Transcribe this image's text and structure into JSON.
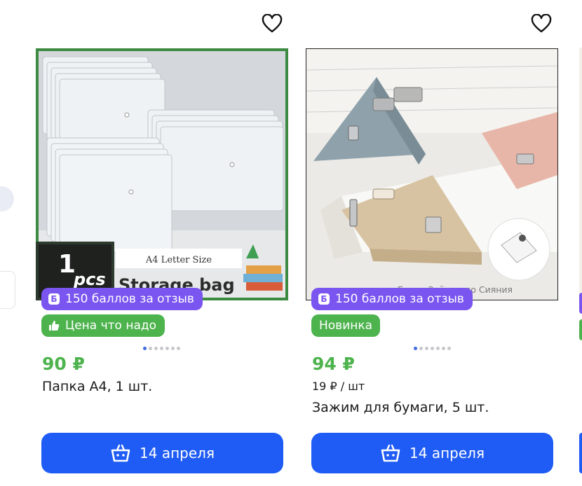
{
  "products": [
    {
      "image_alt": "Storage bag",
      "image_text": {
        "size": "A4 Letter Size",
        "qty": "1",
        "unit": "pcs",
        "name": "Storage bag"
      },
      "points_badge": {
        "icon": "b-points-icon",
        "text": "150 баллов за отзыв"
      },
      "tag_badge": {
        "icon": "thumbs-up-icon",
        "text": "Цена что надо",
        "color": "#4db34d"
      },
      "price": "90 ₽",
      "unit_price": "",
      "title": "Папка А4, 1 шт.",
      "button": {
        "icon": "basket-icon",
        "label": "14 апреля"
      },
      "carousel": {
        "count": 7,
        "active": 0
      }
    },
    {
      "image_alt": "Зажим для бумаги",
      "image_text": {
        "watermark": "Белое Звёздного Сияния"
      },
      "points_badge": {
        "icon": "b-points-icon",
        "text": "150 баллов за отзыв"
      },
      "tag_badge": {
        "icon": "",
        "text": "Новинка",
        "color": "#4db34d"
      },
      "price": "94 ₽",
      "unit_price": "19 ₽ / шт",
      "title": "Зажим для бумаги, 5 шт.",
      "button": {
        "icon": "basket-icon",
        "label": "14 апреля"
      },
      "carousel": {
        "count": 7,
        "active": 0
      }
    }
  ],
  "colors": {
    "accent": "#1f5cf5",
    "points": "#7a55f0",
    "price": "#4db34d"
  }
}
